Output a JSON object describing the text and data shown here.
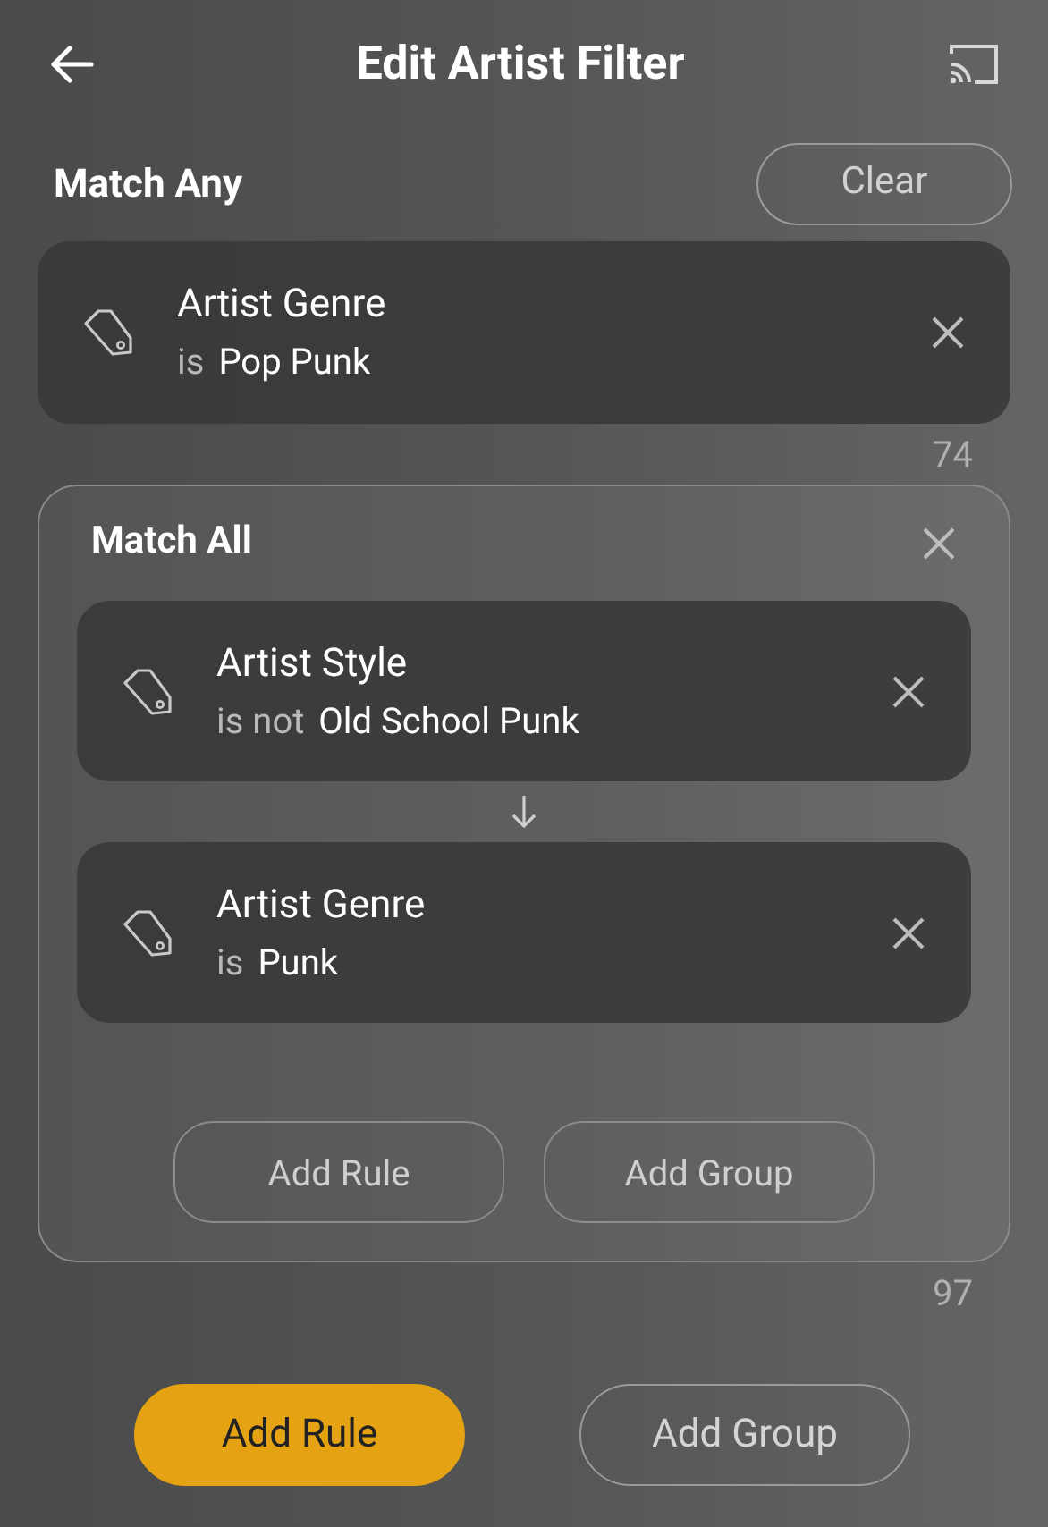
{
  "header": {
    "title": "Edit Artist Filter"
  },
  "root_group": {
    "label": "Match Any",
    "clear_button": "Clear",
    "rules": [
      {
        "field": "Artist Genre",
        "operator": "is",
        "value": "Pop Punk"
      }
    ],
    "count": "74"
  },
  "sub_group": {
    "label": "Match All",
    "rules": [
      {
        "field": "Artist Style",
        "operator": "is not",
        "value": "Old School Punk"
      },
      {
        "field": "Artist Genre",
        "operator": "is",
        "value": "Punk"
      }
    ],
    "buttons": [
      "Add Rule",
      "Add Group"
    ],
    "count": "97"
  },
  "bottom_buttons": [
    {
      "label": "Add Rule",
      "kind": "primary"
    },
    {
      "label": "Add Group",
      "kind": "outline"
    }
  ]
}
